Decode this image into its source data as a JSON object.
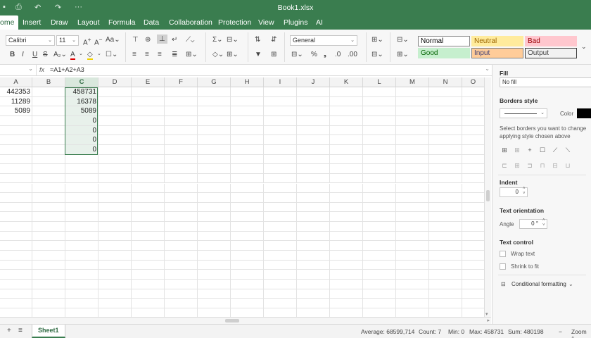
{
  "window": {
    "title": "Book1.xlsx"
  },
  "quick_access": {
    "more": "···"
  },
  "menu": {
    "tabs": [
      "ome",
      "Insert",
      "Draw",
      "Layout",
      "Formula",
      "Data",
      "Collaboration",
      "Protection",
      "View",
      "Plugins",
      "AI"
    ],
    "active_index": 0
  },
  "toolbar": {
    "font_name": "Calibri",
    "font_size": "11",
    "number_format": "General",
    "cell_styles": [
      {
        "label": "Normal",
        "bg": "#ffffff",
        "fg": "#000000",
        "border": "#8a8a8a"
      },
      {
        "label": "Neutral",
        "bg": "#ffeb9c",
        "fg": "#9c6500",
        "border": "#ffeb9c"
      },
      {
        "label": "Bad",
        "bg": "#ffc7ce",
        "fg": "#9c0006",
        "border": "#ffc7ce"
      },
      {
        "label": "Good",
        "bg": "#c6efce",
        "fg": "#006100",
        "border": "#c6efce"
      },
      {
        "label": "Input",
        "bg": "#ffcc99",
        "fg": "#3f3f76",
        "border": "#7f7f7f"
      },
      {
        "label": "Output",
        "bg": "#f2f2f2",
        "fg": "#3f3f3f",
        "border": "#3f3f3f"
      }
    ]
  },
  "formula_bar": {
    "fx": "fx",
    "formula": "=A1+A2+A3"
  },
  "grid": {
    "columns": [
      "A",
      "B",
      "C",
      "D",
      "E",
      "F",
      "G",
      "H",
      "I",
      "J",
      "K",
      "L",
      "M",
      "N",
      "O"
    ],
    "selected_column": "C",
    "column_a": [
      "442353",
      "11289",
      "5089"
    ],
    "column_c": [
      "458731",
      "16378",
      "5089",
      "0",
      "0",
      "0",
      "0"
    ]
  },
  "panel": {
    "fill_label": "Fill",
    "fill_value": "No fill",
    "borders_label": "Borders style",
    "color_label": "Color",
    "border_hint": "Select borders you want to change applying style chosen above",
    "indent_label": "Indent",
    "indent_value": "0",
    "orientation_label": "Text orientation",
    "angle_label": "Angle",
    "angle_value": "0 °",
    "text_control_label": "Text control",
    "wrap_text": "Wrap text",
    "shrink_to_fit": "Shrink to fit",
    "conditional_formatting": "Conditional formatting"
  },
  "status": {
    "sheet_tab": "Sheet1",
    "average": "Average: 68599,714",
    "count": "Count: 7",
    "min": "Min: 0",
    "max": "Max: 458731",
    "sum": "Sum: 480198",
    "zoom": "Zoom 1"
  },
  "colors": {
    "accent": "#3a7d4f",
    "selection_fill": "#e8f1eb"
  }
}
